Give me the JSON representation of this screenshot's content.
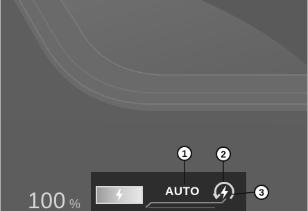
{
  "battery": {
    "percent_value": "100",
    "percent_unit": "%"
  },
  "charge_indicator": {
    "icon": "lightning-bolt-icon"
  },
  "regen_mode": {
    "label": "AUTO",
    "icon": "regen-charge-icon"
  },
  "callouts": {
    "one": "1",
    "two": "2",
    "three": "3"
  },
  "colors": {
    "background": "#5f5f5f",
    "status_bar": "#2d2d2d",
    "text": "#ffffff",
    "callout_fill": "#ffffff",
    "callout_border": "#111111"
  }
}
